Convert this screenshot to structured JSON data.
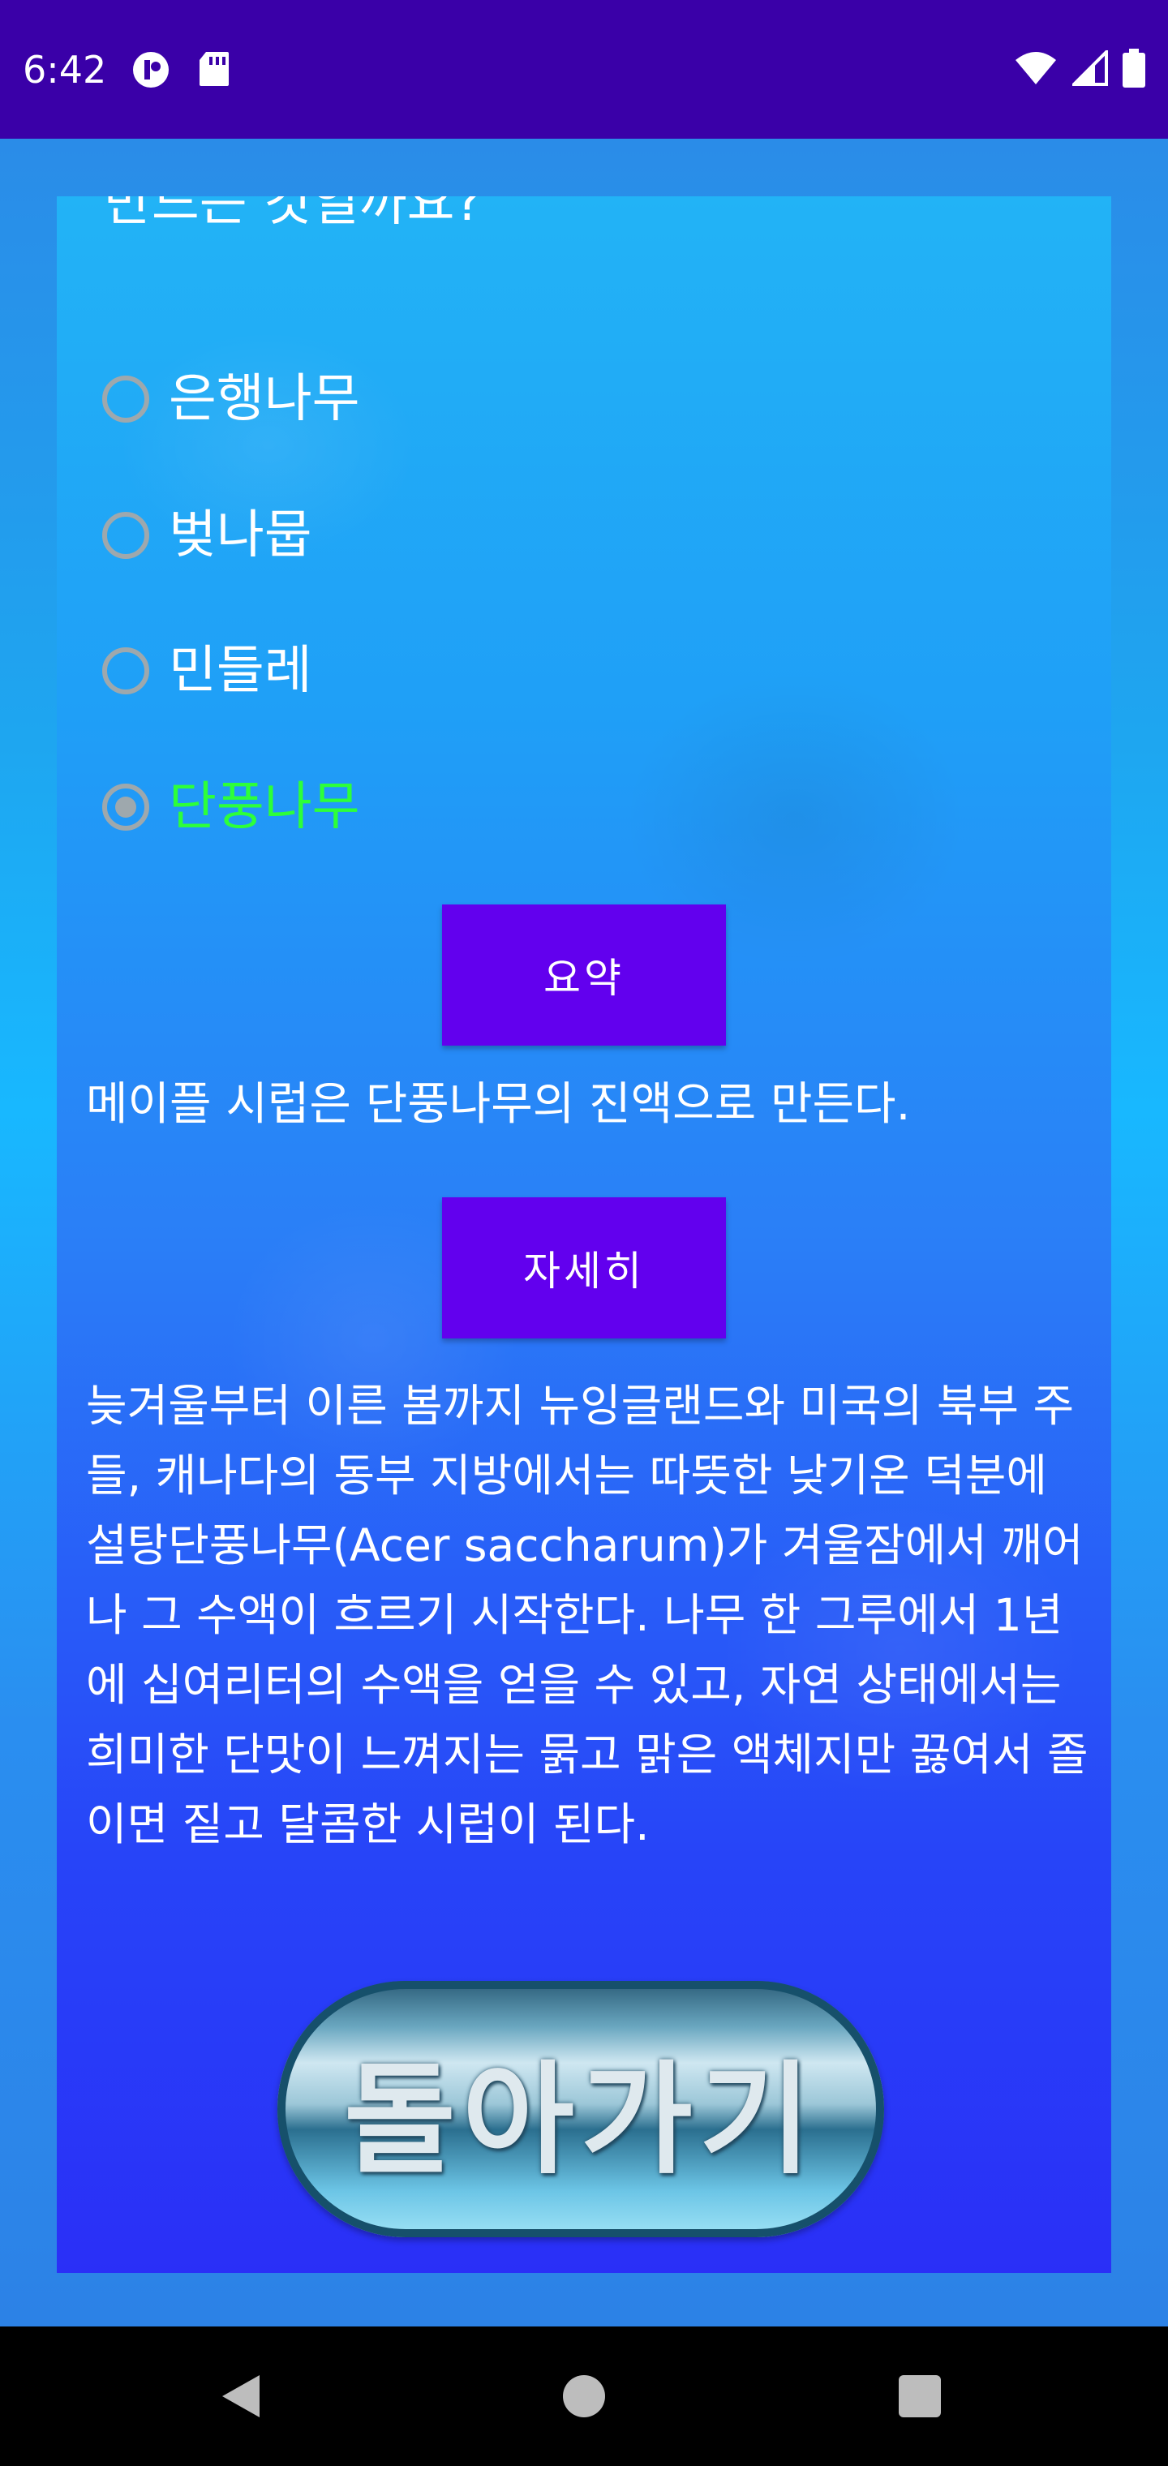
{
  "status_bar": {
    "time": "6:42"
  },
  "question": {
    "fragment": "만드는 것일까요?"
  },
  "options": [
    {
      "label": "은행나무",
      "checked": false
    },
    {
      "label": "벚나뭅",
      "checked": false
    },
    {
      "label": "민들레",
      "checked": false
    },
    {
      "label": "단풍나무",
      "checked": true
    }
  ],
  "summary_button": {
    "label": "요약"
  },
  "summary_text": "메이플 시럽은 단풍나무의 진액으로 만든다.",
  "detail_button": {
    "label": "자세히"
  },
  "detail_text": "늦겨울부터 이른 봄까지 뉴잉글랜드와 미국의 북부 주들, 캐나다의 동부 지방에서는 따뜻한 낮기온 덕분에 설탕단풍나무(Acer saccharum)가 겨울잠에서 깨어나 그 수액이 흐르기 시작한다. 나무 한 그루에서 1년에 십여리터의 수액을 얻을 수 있고, 자연 상태에서는 희미한 단맛이 느껴지는 묽고 맑은 액체지만 끓여서 졸이면 짙고 달콤한 시럽이 된다.",
  "back_button": {
    "label": "돌아가기"
  },
  "colors": {
    "status_bar": "#3a00a8",
    "button": "#6200ee",
    "selected_option": "#2dff3a"
  }
}
